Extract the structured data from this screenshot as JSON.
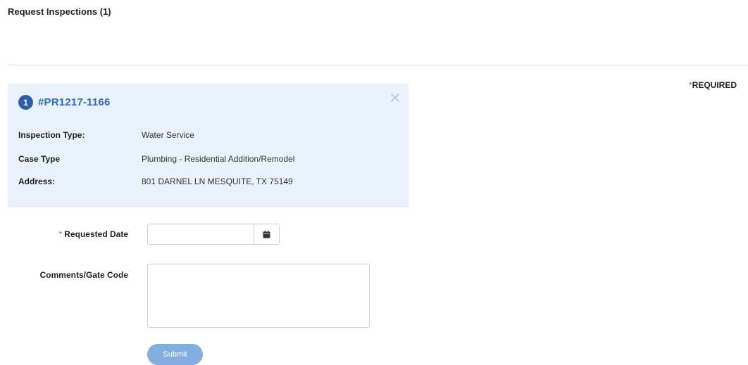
{
  "page": {
    "title": "Request Inspections (1)",
    "required_star": "*",
    "required_label": "REQUIRED"
  },
  "card": {
    "index": "1",
    "permit_number": "#PR1217-1166",
    "close_icon": "close-icon",
    "rows": [
      {
        "label": "Inspection Type:",
        "value": "Water Service"
      },
      {
        "label": "Case Type",
        "value": "Plumbing - Residential Addition/Remodel"
      },
      {
        "label": "Address:",
        "value": "801 DARNEL LN MESQUITE, TX 75149"
      }
    ]
  },
  "form": {
    "requested_date": {
      "star": "*",
      "label": "Requested Date",
      "value": "",
      "icon": "calendar-icon"
    },
    "comments": {
      "label": "Comments/Gate Code",
      "value": ""
    },
    "submit_label": "Submit"
  },
  "colors": {
    "card_background": "#e9f2fb",
    "badge": "#2b5fa8",
    "permit_link": "#2e6db3",
    "required_star": "#d9534f",
    "submit_button": "#84aee0"
  }
}
